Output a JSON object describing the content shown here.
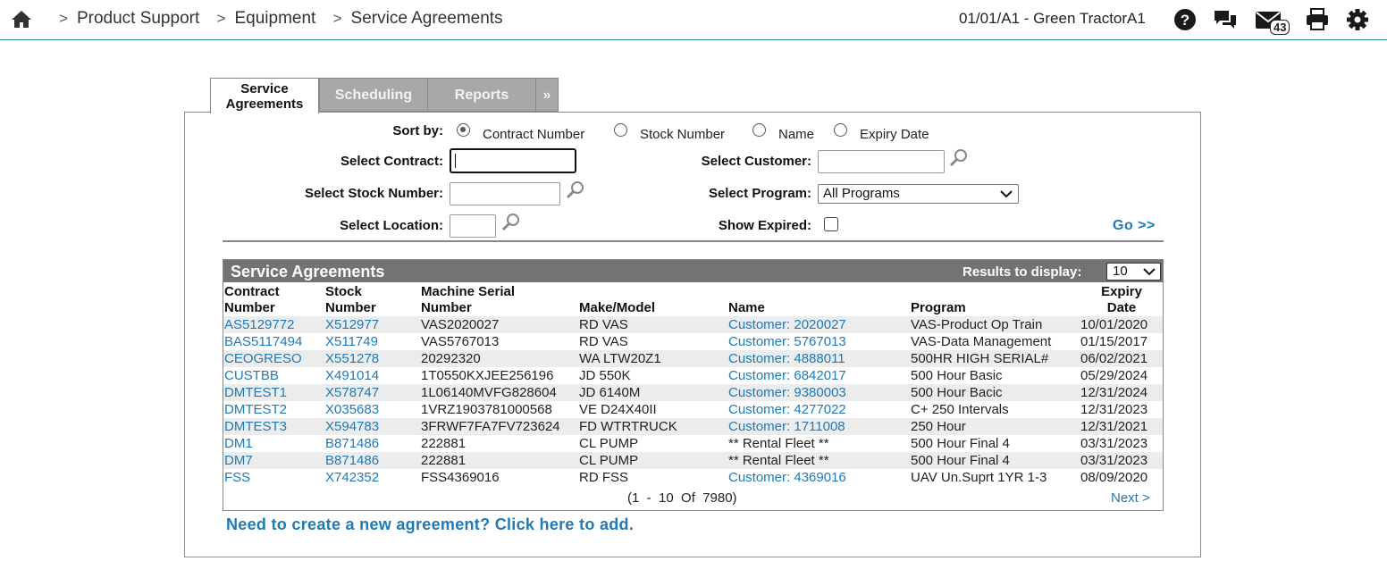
{
  "header": {
    "breadcrumb": [
      {
        "label": "Product Support"
      },
      {
        "label": "Equipment"
      },
      {
        "label": "Service Agreements"
      }
    ],
    "separator": ">",
    "store": "01/01/A1 - Green TractorA1",
    "message_count": "43",
    "icons": [
      "home-icon",
      "help-icon",
      "chat-icon",
      "mail-icon",
      "print-icon",
      "gear-icon"
    ]
  },
  "tabs": {
    "active_line1": "Service",
    "active_line2": "Agreements",
    "scheduling": "Scheduling",
    "reports": "Reports",
    "more": "»"
  },
  "filters": {
    "sort_by_label": "Sort by:",
    "sort_options": [
      "Contract Number",
      "Stock Number",
      "Name",
      "Expiry Date"
    ],
    "sort_selected": "Contract Number",
    "select_contract_label": "Select Contract:",
    "select_contract_value": "",
    "select_customer_label": "Select Customer:",
    "select_customer_value": "",
    "select_stock_label": "Select Stock Number:",
    "select_stock_value": "",
    "select_program_label": "Select Program:",
    "select_program_value": "All Programs",
    "select_location_label": "Select Location:",
    "select_location_value": "",
    "show_expired_label": "Show Expired:",
    "show_expired_checked": false,
    "go_label": "Go >>"
  },
  "grid": {
    "title": "Service Agreements",
    "results_label": "Results to display:",
    "results_value": "10",
    "columns": {
      "contract_l1": "Contract",
      "contract_l2": "Number",
      "stock_l1": "Stock",
      "stock_l2": "Number",
      "serial_l1": "Machine Serial",
      "serial_l2": "Number",
      "make": "Make/Model",
      "name": "Name",
      "program": "Program",
      "expiry_l1": "Expiry",
      "expiry_l2": "Date"
    },
    "rows": [
      {
        "contract": "AS5129772",
        "stock": "X512977",
        "serial": "VAS2020027",
        "make": "RD VAS",
        "name": "Customer: 2020027",
        "name_link": true,
        "program": "VAS-Product Op Train",
        "expiry": "10/01/2020"
      },
      {
        "contract": "BAS5117494",
        "stock": "X511749",
        "serial": "VAS5767013",
        "make": "RD VAS",
        "name": "Customer: 5767013",
        "name_link": true,
        "program": "VAS-Data Management",
        "expiry": "01/15/2017"
      },
      {
        "contract": "CEOGRESO",
        "stock": "X551278",
        "serial": "20292320",
        "make": "WA LTW20Z1",
        "name": "Customer: 4888011",
        "name_link": true,
        "program": "500HR HIGH SERIAL#",
        "expiry": "06/02/2021"
      },
      {
        "contract": "CUSTBB",
        "stock": "X491014",
        "serial": "1T0550KXJEE256196",
        "make": "JD 550K",
        "name": "Customer: 6842017",
        "name_link": true,
        "program": "500 Hour Basic",
        "expiry": "05/29/2024"
      },
      {
        "contract": "DMTEST1",
        "stock": "X578747",
        "serial": "1L06140MVFG828604",
        "make": "JD 6140M",
        "name": "Customer: 9380003",
        "name_link": true,
        "program": "500 Hour Bacic",
        "expiry": "12/31/2024"
      },
      {
        "contract": "DMTEST2",
        "stock": "X035683",
        "serial": "1VRZ1903781000568",
        "make": "VE D24X40II",
        "name": "Customer: 4277022",
        "name_link": true,
        "program": "C+ 250 Intervals",
        "expiry": "12/31/2023"
      },
      {
        "contract": "DMTEST3",
        "stock": "X594783",
        "serial": "3FRWF7FA7FV723624",
        "make": "FD WTRTRUCK",
        "name": "Customer: 1711008",
        "name_link": true,
        "program": "250 Hour",
        "expiry": "12/31/2021"
      },
      {
        "contract": "DM1",
        "stock": "B871486",
        "serial": "222881",
        "make": "CL PUMP",
        "name": "** Rental Fleet **",
        "name_link": false,
        "program": "500 Hour Final 4",
        "expiry": "03/31/2023"
      },
      {
        "contract": "DM7",
        "stock": "B871486",
        "serial": "222881",
        "make": "CL PUMP",
        "name": "** Rental Fleet **",
        "name_link": false,
        "program": "500 Hour Final 4",
        "expiry": "03/31/2023"
      },
      {
        "contract": "FSS",
        "stock": "X742352",
        "serial": "FSS4369016",
        "make": "RD FSS",
        "name": "Customer: 4369016",
        "name_link": true,
        "program": "UAV Un.Suprt 1YR 1-3",
        "expiry": "08/09/2020"
      }
    ],
    "pager": "(1  -  10  Of  7980)",
    "next": "Next >"
  },
  "add_link": "Need to create a new agreement? Click here to add.",
  "colors": {
    "link": "#1f7ab5",
    "header_bar": "#737373",
    "row_alt": "#ececec",
    "topbar_border": "#2a8a8a"
  }
}
